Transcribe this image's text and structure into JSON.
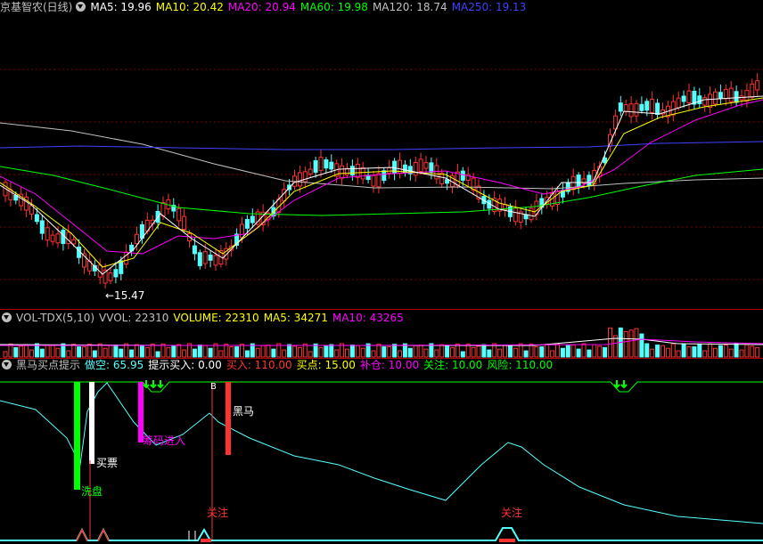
{
  "price_header": {
    "stock": "京基智农(日线)",
    "ma5": "MA5: 19.96",
    "ma10": "MA10: 20.42",
    "ma20": "MA20: 20.94",
    "ma60": "MA60: 19.98",
    "ma120": "MA120: 18.74",
    "ma250": "MA250: 19.13",
    "low_label": "←15.47"
  },
  "volume_header": {
    "name": "VOL-TDX(5,10)",
    "vvol": "VVOL: 22310",
    "volume": "VOLUME: 22310",
    "ma5": "MA5: 34271",
    "ma10": "MA10: 43265"
  },
  "indicator_header": {
    "name": "黑马买点提示",
    "zuokong": "做空: 65.95",
    "tishi": "提示买入: 0.00",
    "mairu": "买入: 110.00",
    "maidian": "买点: 15.00",
    "bucang": "补仓: 10.00",
    "guanzhu": "关注: 10.00",
    "fengxian": "风险: 110.00"
  },
  "signals": {
    "xipan": "洗盘",
    "maipiao": "买票",
    "choumajinru": "筹码进入",
    "heima": "黑马",
    "guanzhu1": "关注",
    "guanzhu2": "关注",
    "b1": "B",
    "b2": "B"
  },
  "colors": {
    "up": "#ff3232",
    "down": "#54ffff",
    "ma5": "#ffffff",
    "ma10": "#ffff00",
    "ma20": "#ff00ff",
    "ma60": "#00ff00",
    "ma120": "#c0c0c0",
    "ma250": "#4040ff",
    "grid": "#800000"
  },
  "chart_data": {
    "type": "candlestick",
    "title": "京基智农(日线)",
    "series_names": [
      "MA5",
      "MA10",
      "MA20",
      "MA60",
      "MA120",
      "MA250"
    ],
    "latest_values": {
      "MA5": 19.96,
      "MA10": 20.42,
      "MA20": 20.94,
      "MA60": 19.98,
      "MA120": 18.74,
      "MA250": 19.13
    },
    "period_low": 15.47
  }
}
